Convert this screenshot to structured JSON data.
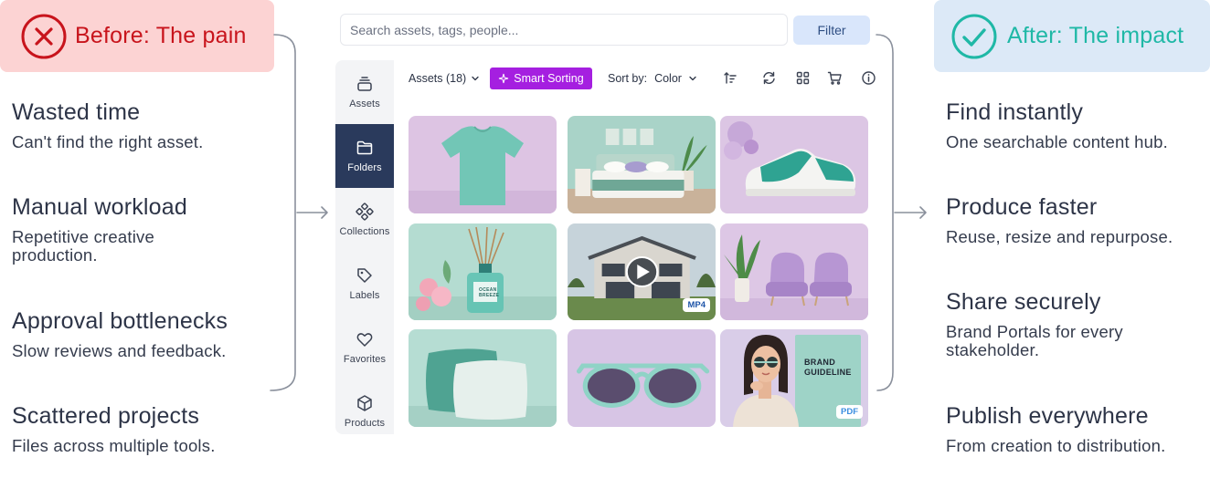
{
  "pain": {
    "banner_title": "Before: The pain",
    "points": [
      {
        "title": "Wasted time",
        "desc": "Can't find the right asset."
      },
      {
        "title": "Manual workload",
        "desc": "Repetitive creative production."
      },
      {
        "title": "Approval bottlenecks",
        "desc": "Slow reviews and feedback."
      },
      {
        "title": "Scattered projects",
        "desc": "Files across multiple tools."
      }
    ]
  },
  "impact": {
    "banner_title": "After: The impact",
    "points": [
      {
        "title": "Find instantly",
        "desc": "One searchable content hub."
      },
      {
        "title": "Produce faster",
        "desc": "Reuse, resize and repurpose."
      },
      {
        "title": "Share securely",
        "desc": "Brand Portals for every stakeholder."
      },
      {
        "title": "Publish everywhere",
        "desc": "From creation to distribution."
      }
    ]
  },
  "app": {
    "search_placeholder": "Search assets, tags, people...",
    "filter_label": "Filter",
    "sidebar": [
      {
        "label": "Assets",
        "icon": "layers-icon"
      },
      {
        "label": "Folders",
        "icon": "folder-icon",
        "active": true
      },
      {
        "label": "Collections",
        "icon": "collections-icon"
      },
      {
        "label": "Labels",
        "icon": "tag-icon"
      },
      {
        "label": "Favorites",
        "icon": "heart-icon"
      },
      {
        "label": "Products",
        "icon": "box-icon"
      }
    ],
    "toolbar": {
      "assets_label": "Assets (18)",
      "smart_sorting_label": "Smart Sorting",
      "sort_by_label": "Sort by:",
      "sort_value": "Color"
    },
    "tiles": [
      {
        "name": "t-shirt"
      },
      {
        "name": "bedroom"
      },
      {
        "name": "sneaker"
      },
      {
        "name": "diffuser",
        "label_lines": [
          "OCEAN",
          "BREEZE"
        ]
      },
      {
        "name": "house-video",
        "badge": "MP4"
      },
      {
        "name": "chairs"
      },
      {
        "name": "pillows"
      },
      {
        "name": "sunglasses"
      },
      {
        "name": "brand-guideline",
        "badge": "PDF",
        "label_lines": [
          "BRAND",
          "GUIDELINE"
        ]
      }
    ]
  },
  "colors": {
    "pain_banner_bg": "#fcd3d3",
    "pain_accent": "#c8141c",
    "impact_banner_bg": "#dce9f7",
    "impact_accent": "#1fb8a6",
    "active_nav": "#2a3a5c",
    "smart_sorting": "#a51fe0",
    "filter_bg": "#d9e6fb"
  }
}
